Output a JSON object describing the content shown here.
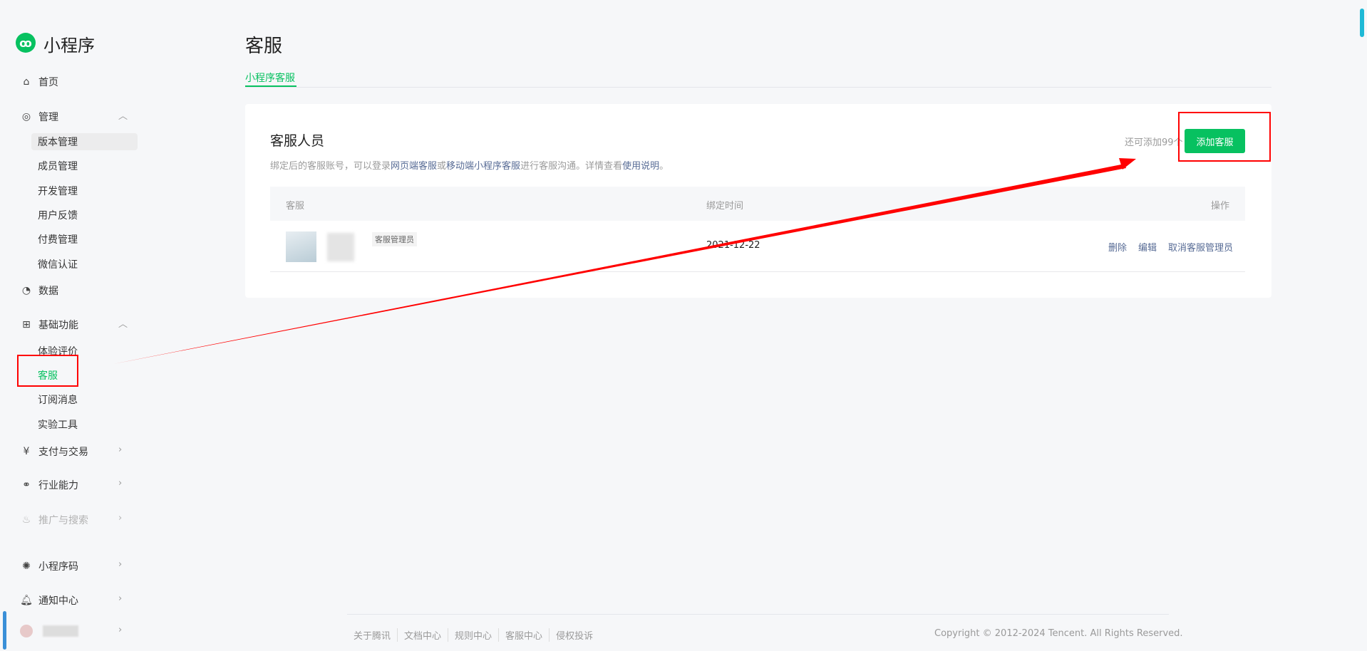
{
  "app": {
    "logo_text": "小程序"
  },
  "sidebar": {
    "home": "首页",
    "manage": {
      "label": "管理",
      "items": [
        "版本管理",
        "成员管理",
        "开发管理",
        "用户反馈",
        "付费管理",
        "微信认证"
      ]
    },
    "data": "数据",
    "basic": {
      "label": "基础功能",
      "items": [
        "体验评价",
        "客服",
        "订阅消息",
        "实验工具"
      ]
    },
    "pay": "支付与交易",
    "industry": "行业能力",
    "promo": "推广与搜索",
    "qrcode": "小程序码",
    "notify": "通知中心"
  },
  "page": {
    "title": "客服",
    "tab": "小程序客服"
  },
  "card": {
    "title": "客服人员",
    "desc_1": "绑定后的客服账号，可以登录",
    "link_web": "网页端客服",
    "desc_2": "或",
    "link_mobile": "移动端小程序客服",
    "desc_3": "进行客服沟通。详情查看",
    "link_help": "使用说明",
    "desc_4": "。",
    "remaining": "还可添加99个",
    "add_button": "添加客服",
    "columns": [
      "客服",
      "绑定时间",
      "操作"
    ],
    "rows": [
      {
        "badge": "客服管理员",
        "date": "2021-12-22",
        "actions": [
          "删除",
          "编辑",
          "取消客服管理员"
        ]
      }
    ]
  },
  "footer": {
    "links": [
      "关于腾讯",
      "文档中心",
      "规则中心",
      "客服中心",
      "侵权投诉"
    ],
    "copyright": "Copyright © 2012-2024 Tencent. All Rights Reserved."
  },
  "colors": {
    "accent": "#07c160",
    "link": "#576b95",
    "annotation": "#ff0000"
  }
}
